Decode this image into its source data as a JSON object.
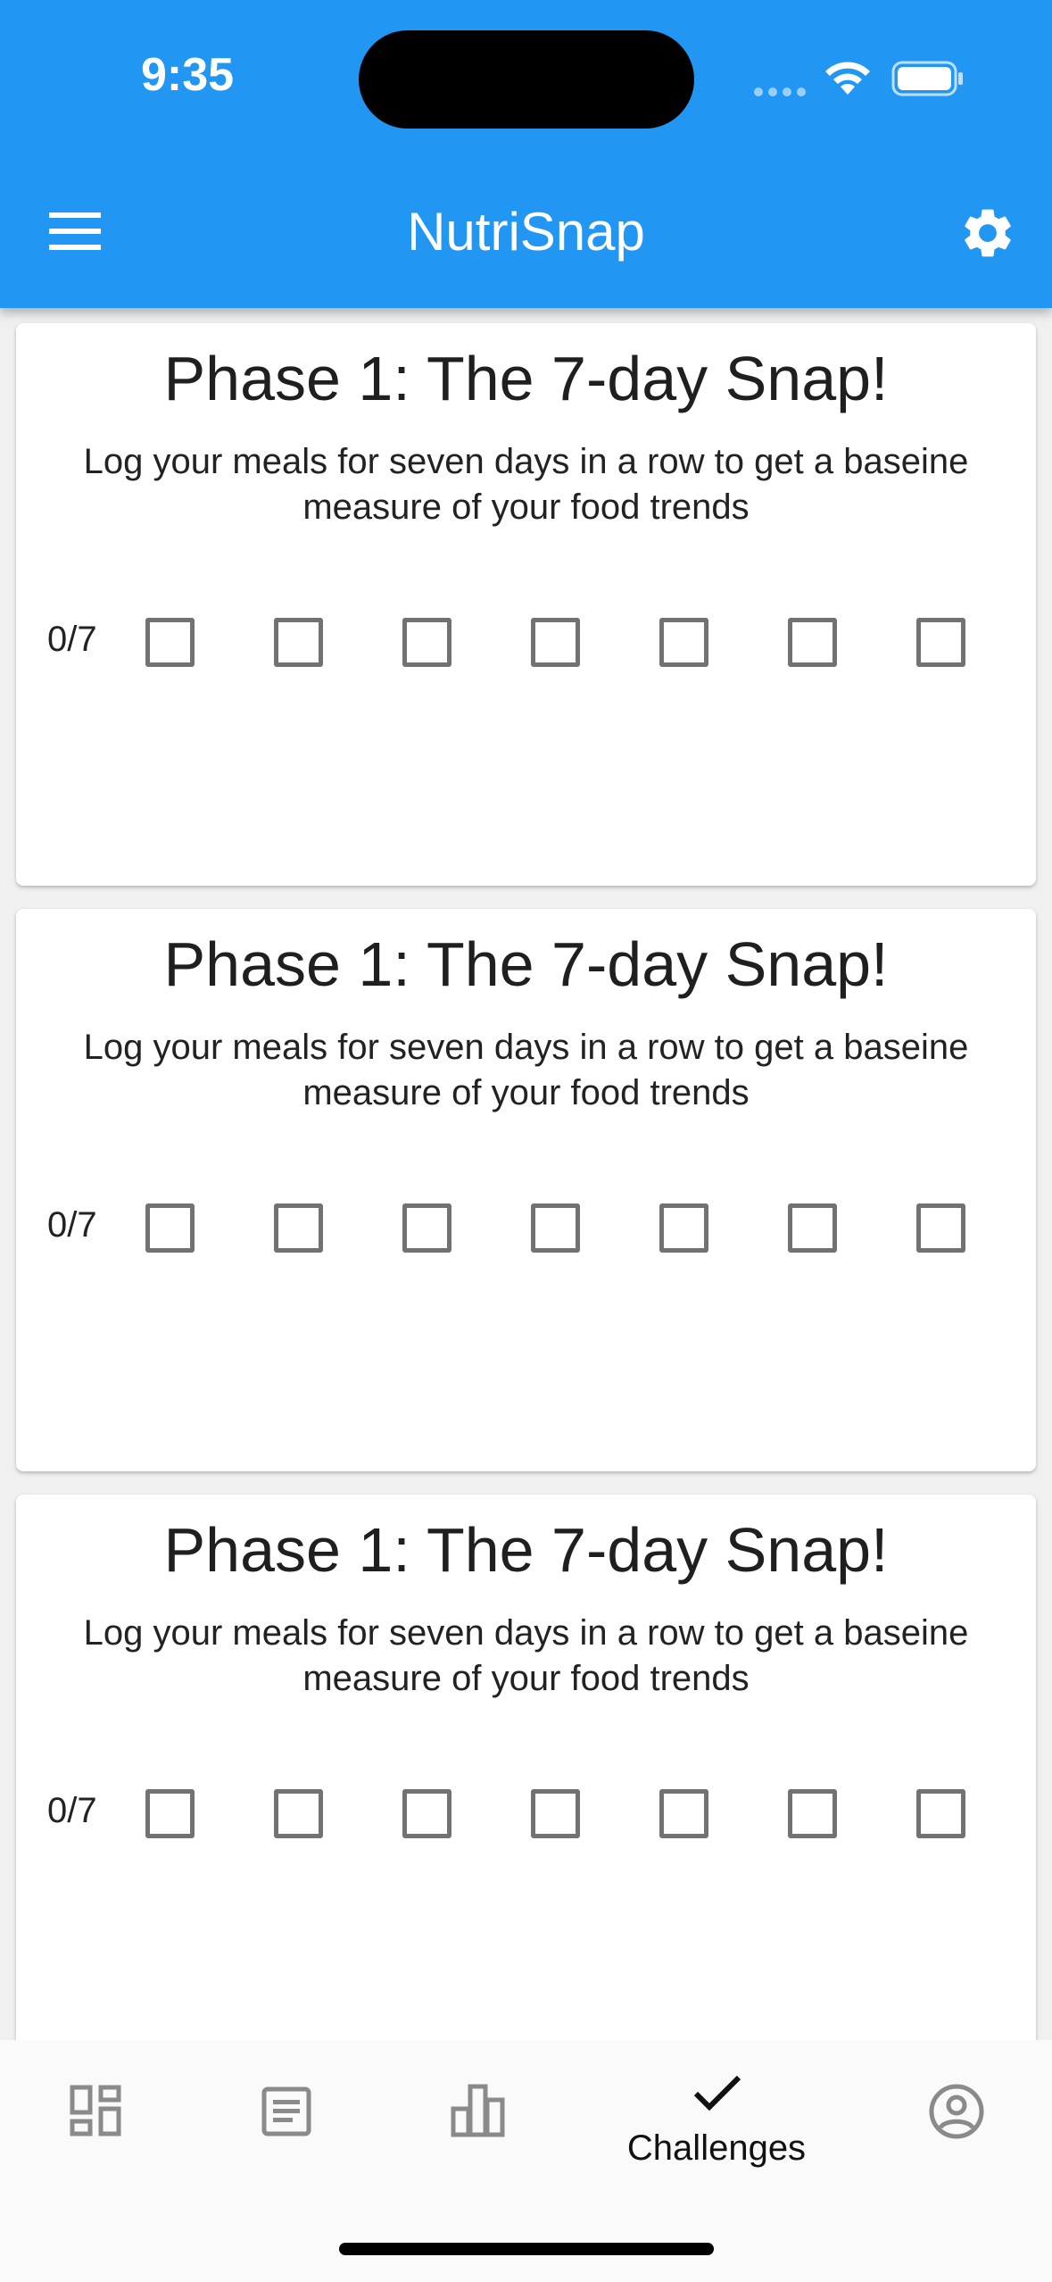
{
  "status_bar": {
    "time": "9:35"
  },
  "appbar": {
    "title": "NutriSnap"
  },
  "cards": [
    {
      "title": "Phase 1: The 7-day Snap!",
      "description": "Log your meals for seven days in a row to get a baseine measure of your food trends",
      "progress": "0/7",
      "checked_days": 0,
      "total_days": 7
    },
    {
      "title": "Phase 1: The 7-day Snap!",
      "description": "Log your meals for seven days in a row to get a baseine measure of your food trends",
      "progress": "0/7",
      "checked_days": 0,
      "total_days": 7
    },
    {
      "title": "Phase 1: The 7-day Snap!",
      "description": "Log your meals for seven days in a row to get a baseine measure of your food trends",
      "progress": "0/7",
      "checked_days": 0,
      "total_days": 7
    }
  ],
  "bottom_nav": {
    "items": [
      {
        "icon": "dashboard-icon",
        "label": ""
      },
      {
        "icon": "article-icon",
        "label": ""
      },
      {
        "icon": "bar-chart-icon",
        "label": ""
      },
      {
        "icon": "check-icon",
        "label": "Challenges",
        "selected": true
      },
      {
        "icon": "account-circle-icon",
        "label": ""
      }
    ]
  },
  "colors": {
    "primary": "#2196f3",
    "icon_gray": "#8a8a8a",
    "checkbox_border": "#727272"
  }
}
